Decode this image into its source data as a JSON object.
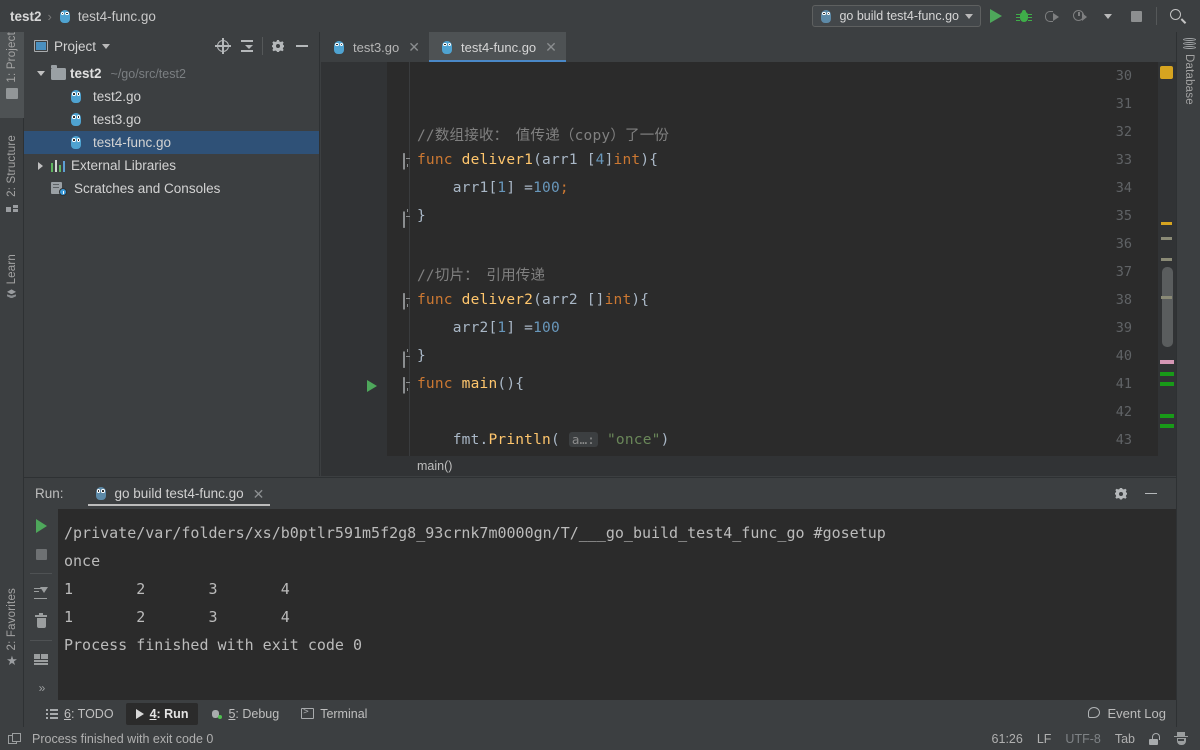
{
  "window": {
    "breadcrumb": {
      "project": "test2",
      "separator": "›",
      "file": "test4-func.go"
    }
  },
  "toolbar": {
    "run_config": "go build test4-func.go",
    "icons": [
      "gopher-icon",
      "chevron-down-icon",
      "run-icon",
      "debug-icon",
      "run-with-coverage-icon",
      "profiler-icon",
      "chevron-down-icon",
      "stop-icon",
      "search-icon"
    ]
  },
  "left_stripe": {
    "items": [
      {
        "label": "1: Project",
        "icon": "project-icon",
        "active": true
      },
      {
        "label": "2: Structure",
        "icon": "structure-icon",
        "active": false
      },
      {
        "label": "Learn",
        "icon": "learn-icon",
        "active": false
      }
    ],
    "bottom_items": [
      {
        "label": "2: Favorites",
        "icon": "star-icon",
        "active": false
      }
    ]
  },
  "right_stripe": {
    "items": [
      {
        "label": "Database",
        "icon": "database-icon"
      }
    ]
  },
  "project_panel": {
    "title": "Project",
    "tools": [
      "locate-icon",
      "collapse-all-icon",
      "gear-icon",
      "minimize-icon"
    ],
    "tree": [
      {
        "label": "test2",
        "path": "~/go/src/test2",
        "icon": "folder-icon",
        "twisty": "down",
        "indent": 0,
        "bold": true,
        "selected": false
      },
      {
        "label": "test2.go",
        "path": "",
        "icon": "gopher-icon",
        "twisty": "none",
        "indent": 1,
        "bold": false,
        "selected": false
      },
      {
        "label": "test3.go",
        "path": "",
        "icon": "gopher-icon",
        "twisty": "none",
        "indent": 1,
        "bold": false,
        "selected": false
      },
      {
        "label": "test4-func.go",
        "path": "",
        "icon": "gopher-icon",
        "twisty": "none",
        "indent": 1,
        "bold": false,
        "selected": true
      },
      {
        "label": "External Libraries",
        "path": "",
        "icon": "library-icon",
        "twisty": "right",
        "indent": 0,
        "bold": false,
        "selected": false
      },
      {
        "label": "Scratches and Consoles",
        "path": "",
        "icon": "scratches-icon",
        "twisty": "none",
        "indent": 0,
        "bold": false,
        "selected": false
      }
    ]
  },
  "editor": {
    "tabs": [
      {
        "label": "test3.go",
        "active": false
      },
      {
        "label": "test4-func.go",
        "active": true
      }
    ],
    "breadcrumb_bottom": "main()",
    "lines": [
      {
        "n": "30",
        "text": ""
      },
      {
        "n": "31",
        "text": ""
      },
      {
        "n": "32",
        "text": "//数组接收：　值传递（copy）了一份"
      },
      {
        "n": "33",
        "text": "func deliver1(arr1 [4]int){"
      },
      {
        "n": "34",
        "text": "    arr1[1] =100;"
      },
      {
        "n": "35",
        "text": "}"
      },
      {
        "n": "36",
        "text": ""
      },
      {
        "n": "37",
        "text": "//切片：　引用传递"
      },
      {
        "n": "38",
        "text": "func deliver2(arr2 []int){"
      },
      {
        "n": "39",
        "text": "    arr2[1] =100"
      },
      {
        "n": "40",
        "text": "}"
      },
      {
        "n": "41",
        "text": "func main(){"
      },
      {
        "n": "42",
        "text": ""
      },
      {
        "n": "43",
        "text": "    fmt.Println( a…: \"once\")"
      }
    ],
    "inlay_hint": "a…:"
  },
  "run_panel": {
    "label": "Run:",
    "tab": "go build test4-func.go",
    "tools": [
      "rerun-icon",
      "stop-icon",
      "scroll-to-end-icon",
      "clear-all-icon",
      "layout-icon",
      "expand-icon"
    ],
    "header_tools": [
      "gear-icon",
      "minimize-icon"
    ],
    "console": [
      "/private/var/folders/xs/b0ptlr591m5f2g8_93crnk7m0000gn/T/___go_build_test4_func_go #gosetup",
      "once",
      "1\t2\t3\t4",
      "1\t2\t3\t4",
      "Process finished with exit code 0"
    ]
  },
  "bottom_bar": {
    "items": [
      {
        "num": "6",
        "label": ": TODO",
        "icon": "todo-icon",
        "active": false
      },
      {
        "num": "4",
        "label": ": Run",
        "icon": "run-icon",
        "active": true
      },
      {
        "num": "5",
        "label": ": Debug",
        "icon": "debug-icon",
        "active": false
      },
      {
        "num": "",
        "label": "Terminal",
        "icon": "terminal-icon",
        "active": false
      }
    ],
    "event_log": "Event Log"
  },
  "status_bar": {
    "message": "Process finished with exit code 0",
    "caret": "61:26",
    "line_separator": "LF",
    "encoding": "UTF-8",
    "indent": "Tab",
    "icons": [
      "lock-icon",
      "hector-icon"
    ]
  },
  "colors": {
    "accent_blue": "#4a88c7",
    "selection": "#2f5177",
    "editor_bg": "#2b2b2b",
    "panel_bg": "#3c3f41",
    "keyword": "#cc7832",
    "function": "#ffc66d",
    "number": "#6897bb",
    "string": "#6a8759",
    "comment": "#808080",
    "run_green": "#4ea75b"
  }
}
